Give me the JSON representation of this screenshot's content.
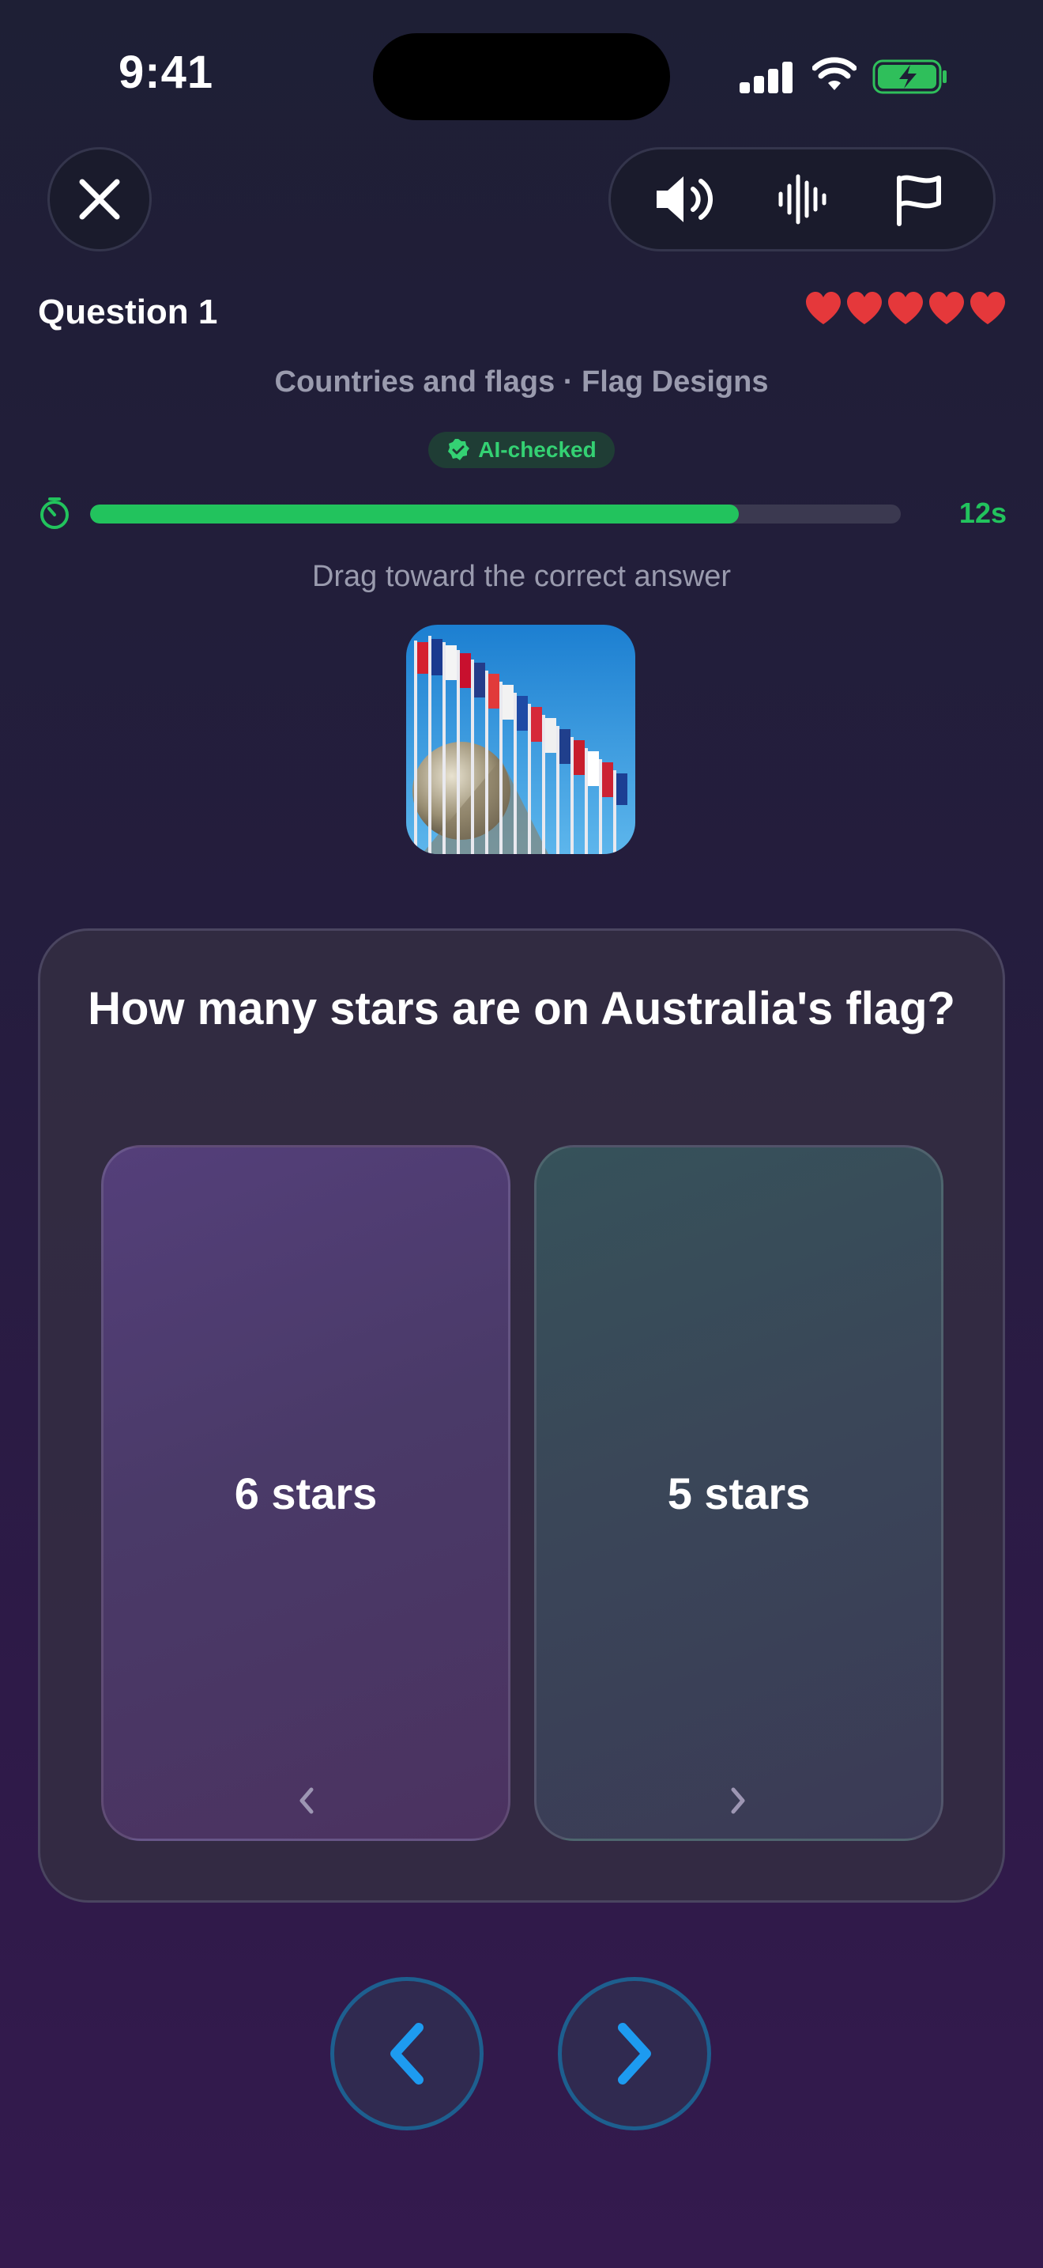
{
  "status_bar": {
    "time": "9:41",
    "signal_icon": "cellular-signal-icon",
    "wifi_icon": "wifi-icon",
    "battery_icon": "battery-charging-icon"
  },
  "toolbar": {
    "close_icon": "close-icon",
    "tools": [
      {
        "icon": "speaker-icon",
        "name": "sound"
      },
      {
        "icon": "waveform-icon",
        "name": "voice"
      },
      {
        "icon": "flag-icon",
        "name": "report"
      }
    ]
  },
  "quiz": {
    "question_label": "Question 1",
    "lives": 5,
    "category": "Countries and flags · Flag Designs",
    "ai_badge": "AI-checked",
    "timer_progress": 0.8,
    "timer_text": "12s",
    "instruction": "Drag toward the correct answer",
    "question": "How many stars are on Australia's flag?",
    "answers": [
      {
        "label": "6 stars",
        "hint_icon": "chevron-left-icon"
      },
      {
        "label": "5 stars",
        "hint_icon": "chevron-right-icon"
      }
    ]
  },
  "navigation": {
    "prev_icon": "chevron-left-icon",
    "next_icon": "chevron-right-icon"
  },
  "colors": {
    "accent_green": "#22c35d",
    "heart_red": "#e5383b",
    "nav_blue": "#1d9bf0"
  }
}
